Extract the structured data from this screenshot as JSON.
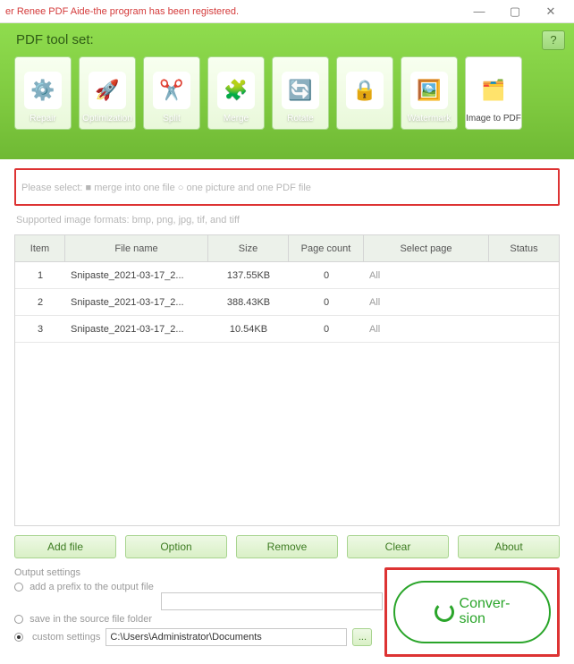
{
  "titlebar": {
    "title": "er Renee PDF Aide-the program has been registered."
  },
  "toolbar": {
    "heading": "PDF tool set:",
    "help": "?",
    "tools": [
      {
        "label": "Repair",
        "icon": "⚙️"
      },
      {
        "label": "Optimization",
        "icon": "🚀"
      },
      {
        "label": "Split",
        "icon": "✂️"
      },
      {
        "label": "Merge",
        "icon": "🧩"
      },
      {
        "label": "Rotate",
        "icon": "🔄"
      },
      {
        "label": "",
        "icon": "🔒"
      },
      {
        "label": "Watermark",
        "icon": "🖼️"
      },
      {
        "label": "Image to PDF",
        "icon": "🗂️"
      }
    ]
  },
  "guidance": {
    "select_text": "Please select: ■ merge into one file  ○ one picture and one PDF file",
    "supported": "Supported image formats: bmp, png, jpg, tif, and tiff"
  },
  "table": {
    "headers": {
      "item": "Item",
      "filename": "File name",
      "size": "Size",
      "pagecount": "Page count",
      "selectpage": "Select page",
      "status": "Status"
    },
    "rows": [
      {
        "n": "1",
        "name": "Snipaste_2021-03-17_2...",
        "size": "137.55KB",
        "pages": "0",
        "select": "All",
        "status": ""
      },
      {
        "n": "2",
        "name": "Snipaste_2021-03-17_2...",
        "size": "388.43KB",
        "pages": "0",
        "select": "All",
        "status": ""
      },
      {
        "n": "3",
        "name": "Snipaste_2021-03-17_2...",
        "size": "10.54KB",
        "pages": "0",
        "select": "All",
        "status": ""
      }
    ]
  },
  "buttons": {
    "addfile": "Add file",
    "option": "Option",
    "remove": "Remove",
    "clear": "Clear",
    "about": "About"
  },
  "output": {
    "heading": "Output settings",
    "prefix_label": "add a prefix to the output file",
    "prefix_value": "",
    "savesrc_label": "save in the source file folder",
    "custom_label": "custom settings",
    "custom_value": "C:\\Users\\Administrator\\Documents",
    "browse": "..."
  },
  "conversion": {
    "label": "Conver-\nsion"
  }
}
